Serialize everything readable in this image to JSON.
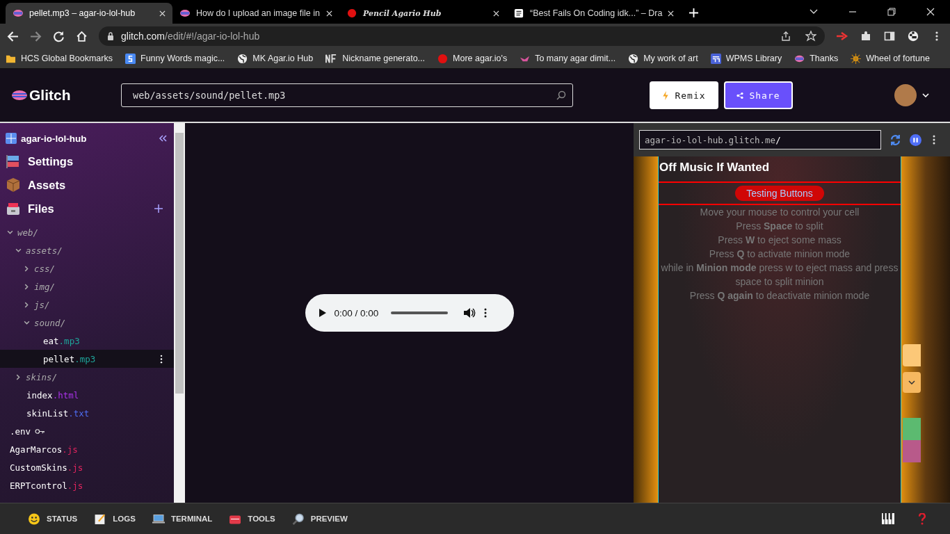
{
  "browser": {
    "tabs": [
      {
        "title": "pellet.mp3 – agar-io-lol-hub",
        "selected": true,
        "kind": "glitch"
      },
      {
        "title": "How do I upload an image file in",
        "selected": false,
        "kind": "glitch"
      },
      {
        "title": "Pencil Agario Hub",
        "selected": false,
        "kind": "dot"
      },
      {
        "title": "“Best Fails On Coding idk...” – Dra",
        "selected": false,
        "kind": "doc"
      }
    ],
    "url_host": "glitch.com",
    "url_path": "/edit/#!/agar-io-lol-hub",
    "bookmarks": [
      {
        "label": "HCS Global Bookmarks",
        "kind": "folder"
      },
      {
        "label": "Funny Words magic...",
        "kind": "s"
      },
      {
        "label": "MK Agar.io Hub",
        "kind": "globe"
      },
      {
        "label": "Nickname generato...",
        "kind": "nf"
      },
      {
        "label": "More agar.io's",
        "kind": "dot"
      },
      {
        "label": "To many agar dimit...",
        "kind": "bird"
      },
      {
        "label": "My work of art",
        "kind": "globe"
      },
      {
        "label": "WPMS Library",
        "kind": "grid"
      },
      {
        "label": "Thanks",
        "kind": "glitch"
      },
      {
        "label": "Wheel of fortune",
        "kind": "sun"
      }
    ]
  },
  "header": {
    "logo": "Glitch",
    "path": "web/assets/sound/pellet.mp3",
    "remix": "Remix",
    "share": "Share"
  },
  "sidebar": {
    "project": "agar-io-lol-hub",
    "sections": [
      {
        "label": "Settings",
        "kind": "settings"
      },
      {
        "label": "Assets",
        "kind": "assets"
      },
      {
        "label": "Files",
        "kind": "files"
      }
    ],
    "files": [
      {
        "kind": "folder",
        "name": "web/",
        "expanded": true,
        "children": [
          {
            "kind": "folder",
            "name": "assets/",
            "expanded": true,
            "children": [
              {
                "kind": "folder",
                "name": "css/",
                "expanded": false
              },
              {
                "kind": "folder",
                "name": "img/",
                "expanded": false
              },
              {
                "kind": "folder",
                "name": "js/",
                "expanded": false
              },
              {
                "kind": "folder",
                "name": "sound/",
                "expanded": true,
                "children": [
                  {
                    "kind": "file",
                    "name": "eat",
                    "ext": ".mp3",
                    "color": "#1ea59a",
                    "selected": false
                  },
                  {
                    "kind": "file",
                    "name": "pellet",
                    "ext": ".mp3",
                    "color": "#1ea59a",
                    "selected": true
                  }
                ]
              }
            ]
          },
          {
            "kind": "folder",
            "name": "skins/",
            "expanded": false
          },
          {
            "kind": "file",
            "name": "index",
            "ext": ".html",
            "color": "#a832e8",
            "selected": false
          },
          {
            "kind": "file",
            "name": "skinList",
            "ext": ".txt",
            "color": "#4d6cf0",
            "selected": false
          }
        ]
      },
      {
        "kind": "env",
        "name": ".env",
        "selected": false
      },
      {
        "kind": "file",
        "name": "AgarMarcos",
        "ext": ".js",
        "color": "#e0245e",
        "selected": false
      },
      {
        "kind": "file",
        "name": "CustomSkins",
        "ext": ".js",
        "color": "#e0245e",
        "selected": false
      },
      {
        "kind": "file",
        "name": "ERPTcontrol",
        "ext": ".js",
        "color": "#e0245e",
        "selected": false
      }
    ]
  },
  "player": {
    "time": "0:00 / 0:00",
    "level": 0
  },
  "preview": {
    "url_host": "agar-io-lol-hub.glitch.me",
    "url_slash": "/",
    "heading": "Off Music If Wanted",
    "button": "Testing Buttons",
    "lines": [
      "Move your mouse to control your cell",
      "Press **Space** to split",
      "Press **W** to eject some mass",
      "Press **Q** to activate minion mode",
      "while in **Minion mode** press w to eject mass and press space to split minion",
      "Press **Q again** to deactivate minion mode"
    ]
  },
  "bottom_bar": [
    {
      "label": "STATUS",
      "kind": "status"
    },
    {
      "label": "LOGS",
      "kind": "logs"
    },
    {
      "label": "TERMINAL",
      "kind": "terminal"
    },
    {
      "label": "TOOLS",
      "kind": "tools"
    },
    {
      "label": "PREVIEW",
      "kind": "preview"
    }
  ]
}
